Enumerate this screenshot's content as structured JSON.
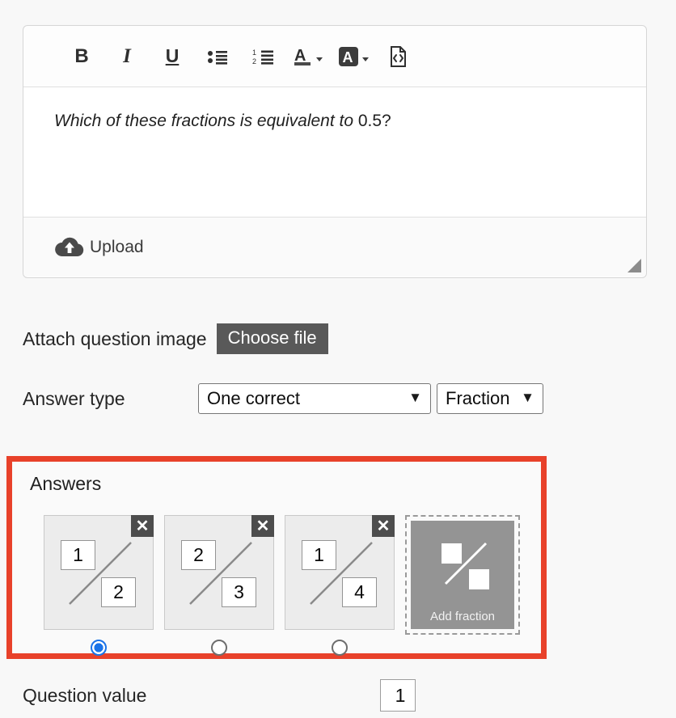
{
  "editor": {
    "toolbar": [
      {
        "name": "bold-icon",
        "label": "B"
      },
      {
        "name": "italic-icon",
        "label": "I"
      },
      {
        "name": "underline-icon",
        "label": "U"
      },
      {
        "name": "bulleted-list-icon",
        "label": "•≡"
      },
      {
        "name": "numbered-list-icon",
        "label": "≡"
      },
      {
        "name": "text-color-icon",
        "label": "A"
      },
      {
        "name": "highlight-color-icon",
        "label": "A"
      },
      {
        "name": "source-code-icon",
        "label": "◇"
      }
    ],
    "content_italic": "Which of these fractions is equivalent to",
    "content_plain": " 0.5?",
    "upload_label": "Upload",
    "upload_icon": "cloud-upload-icon",
    "resize_grip": "resize-grip"
  },
  "attach_row": {
    "label": "Attach question image",
    "button_label": "Choose file"
  },
  "answer_type_row": {
    "label": "Answer type",
    "mode_value": "One correct",
    "mode_options": [
      "One correct"
    ],
    "kind_value": "Fraction",
    "kind_options": [
      "Fraction"
    ]
  },
  "answers": {
    "title": "Answers",
    "highlight_color": "#e8412a",
    "close_glyph": "✕",
    "items": [
      {
        "numerator": "1",
        "denominator": "2",
        "selected": true
      },
      {
        "numerator": "2",
        "denominator": "3",
        "selected": false
      },
      {
        "numerator": "1",
        "denominator": "4",
        "selected": false
      }
    ],
    "add_tile": {
      "label": "Add fraction"
    }
  },
  "question_value_row": {
    "label": "Question value",
    "value": "1"
  }
}
